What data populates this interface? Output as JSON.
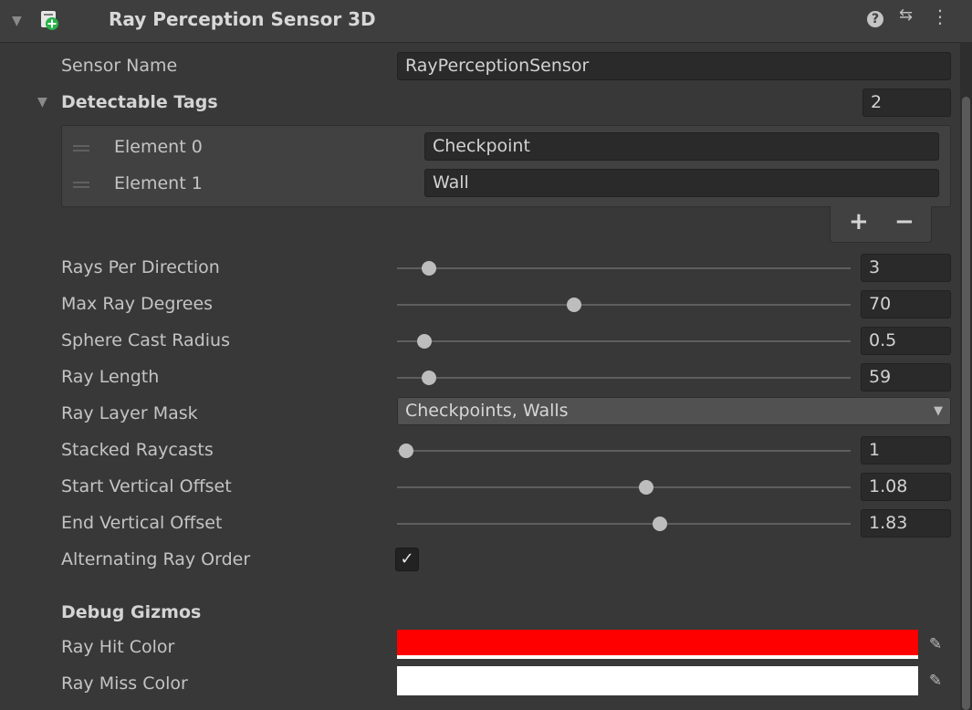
{
  "component": {
    "title": "Ray Perception Sensor 3D",
    "fold_glyph": "▼",
    "icon": "sensor-component-icon",
    "header_icons": [
      "help-icon",
      "presets-icon",
      "kebab-menu-icon"
    ],
    "help_glyph": "?",
    "presets_glyph": "⇆",
    "menu_glyph": "⋮"
  },
  "sensor_name": {
    "label": "Sensor Name",
    "value": "RayPerceptionSensor"
  },
  "detectable_tags": {
    "label": "Detectable Tags",
    "fold_glyph": "▼",
    "count": "2",
    "elements": [
      {
        "label": "Element 0",
        "value": "Checkpoint"
      },
      {
        "label": "Element 1",
        "value": "Wall"
      }
    ],
    "add_label": "+",
    "remove_label": "−"
  },
  "sliders": [
    {
      "label": "Rays Per Direction",
      "value": "3",
      "fraction": 0.07
    },
    {
      "label": "Max Ray Degrees",
      "value": "70",
      "fraction": 0.39
    },
    {
      "label": "Sphere Cast Radius",
      "value": "0.5",
      "fraction": 0.06
    },
    {
      "label": "Ray Length",
      "value": "59",
      "fraction": 0.07
    }
  ],
  "ray_layer_mask": {
    "label": "Ray Layer Mask",
    "value": "Checkpoints, Walls",
    "caret": "▼"
  },
  "sliders2": [
    {
      "label": "Stacked Raycasts",
      "value": "1",
      "fraction": 0.02
    },
    {
      "label": "Start Vertical Offset",
      "value": "1.08",
      "fraction": 0.55
    },
    {
      "label": "End Vertical Offset",
      "value": "1.83",
      "fraction": 0.58
    }
  ],
  "alternating_ray_order": {
    "label": "Alternating Ray Order",
    "checked": true,
    "glyph": "✓"
  },
  "debug_gizmos": {
    "heading": "Debug Gizmos",
    "ray_hit_color": {
      "label": "Ray Hit Color",
      "color": "#ff0000"
    },
    "ray_miss_color": {
      "label": "Ray Miss Color",
      "color": "#ffffff"
    },
    "picker_glyph": "✎"
  }
}
